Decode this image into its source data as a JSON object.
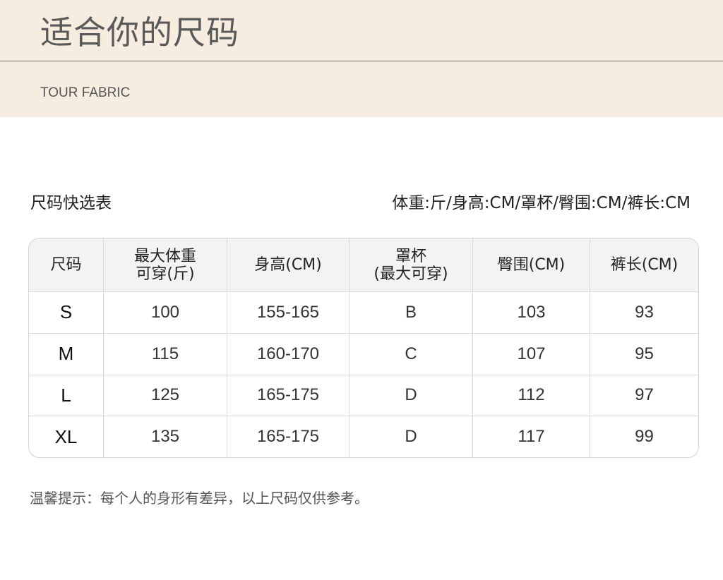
{
  "header": {
    "title": "适合你的尺码",
    "subtitle": "TOUR FABRIC",
    "background_color": "#f6ecdf"
  },
  "table_section": {
    "title": "尺码快选表",
    "units_note": "体重:斤/身高:CM/罩杯/臀围:CM/裤长:CM"
  },
  "size_table": {
    "columns": [
      "尺码",
      "最大体重\n可穿(斤)",
      "身高(CM)",
      "罩杯\n(最大可穿)",
      "臀围(CM)",
      "裤长(CM)"
    ],
    "rows": [
      [
        "S",
        "100",
        "155-165",
        "B",
        "103",
        "93"
      ],
      [
        "M",
        "115",
        "160-170",
        "C",
        "107",
        "95"
      ],
      [
        "L",
        "125",
        "165-175",
        "D",
        "112",
        "97"
      ],
      [
        "XL",
        "135",
        "165-175",
        "D",
        "117",
        "99"
      ]
    ]
  },
  "footer": {
    "tip": "温馨提示：每个人的身形有差异，以上尺码仅供参考。"
  }
}
